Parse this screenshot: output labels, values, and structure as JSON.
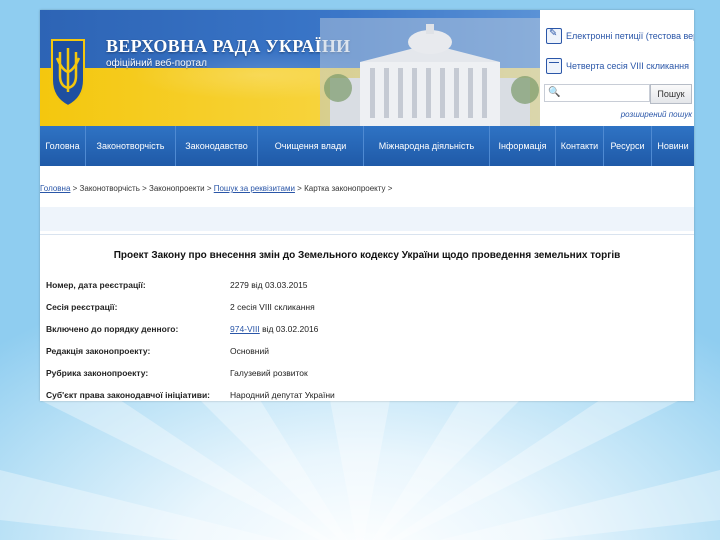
{
  "header": {
    "site_title": "ВЕРХОВНА РАДА УКРАЇНИ",
    "site_subtitle": "офіційний веб-портал",
    "petitions_link": "Електронні петиції (тестова версія)",
    "session_link": "Четверта сесія VIII скликання",
    "search": {
      "placeholder": "",
      "button": "Пошук"
    },
    "advanced_search": "розширений пошук"
  },
  "nav": {
    "items": [
      "Головна",
      "Законотворчість",
      "Законодавство",
      "Очищення влади",
      "Міжнародна діяльність",
      "Інформація",
      "Контакти",
      "Ресурси",
      "Новини"
    ]
  },
  "breadcrumb": {
    "home": "Головна",
    "sep": " > ",
    "lawmaking": "Законотворчість",
    "bills": "Законопроекти",
    "search_by_details": "Пошук за реквізитами",
    "card": "Картка законопроекту",
    "tail": " >"
  },
  "bill": {
    "title": "Проект Закону про внесення змін до Земельного кодексу України щодо проведення земельних торгів",
    "fields": [
      {
        "label": "Номер, дата реєстрації:",
        "value": "2279 від 03.03.2015"
      },
      {
        "label": "Сесія реєстрації:",
        "value": "2 сесія VIII скликання"
      },
      {
        "label": "Включено до порядку денного:",
        "link": "974-VIII",
        "value": " від 03.02.2016"
      },
      {
        "label": "Редакція законопроекту:",
        "value": "Основний"
      },
      {
        "label": "Рубрика законопроекту:",
        "value": "Галузевий розвиток"
      },
      {
        "label": "Суб'єкт права законодавчої ініціативи:",
        "value": "Народний депутат України"
      }
    ]
  },
  "colors": {
    "nav_blue": "#1f5aa8",
    "flag_blue": "#2d64b5",
    "flag_yellow": "#f4c70e",
    "link": "#2a56a8"
  }
}
